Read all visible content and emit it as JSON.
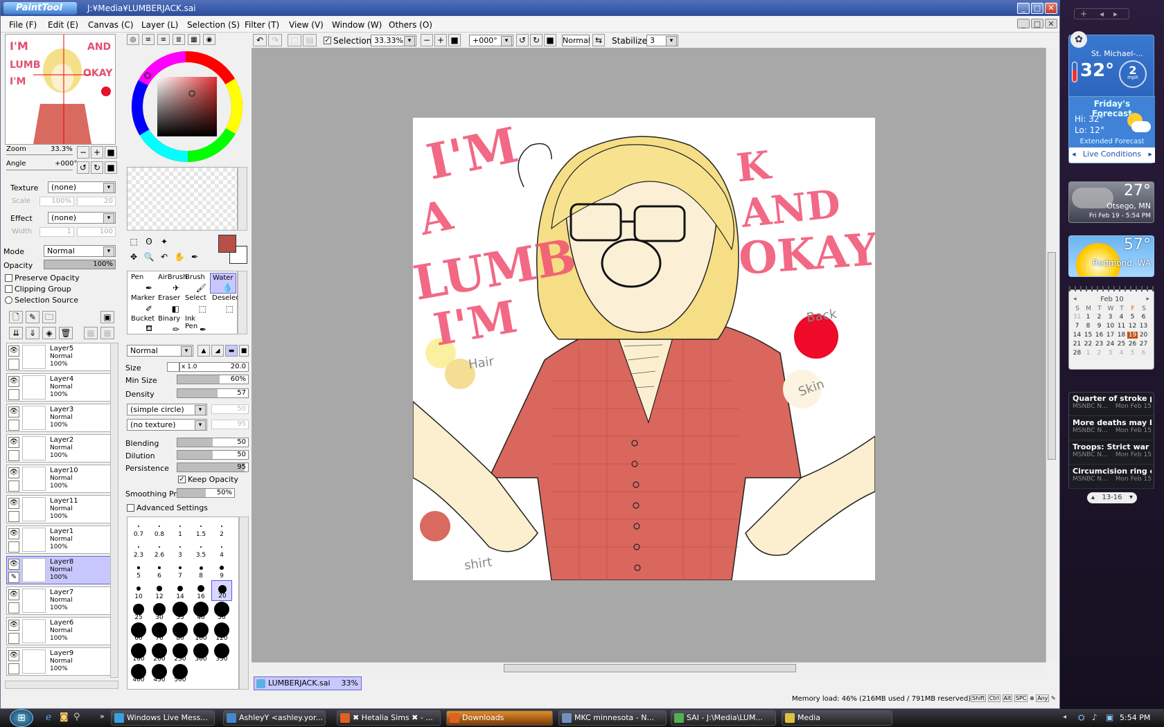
{
  "window": {
    "app": "PaintTool SAI",
    "title": "J:¥Media¥LUMBERJACK.sai"
  },
  "menu": [
    "File (F)",
    "Edit (E)",
    "Canvas (C)",
    "Layer (L)",
    "Selection (S)",
    "Filter (T)",
    "View (V)",
    "Window (W)",
    "Others (O)"
  ],
  "navigator": {
    "zoom_label": "Zoom",
    "zoom_value": "33.3%",
    "angle_label": "Angle",
    "angle_value": "+000°"
  },
  "layer_props": {
    "texture_label": "Texture",
    "texture_value": "(none)",
    "scale_label": "Scale",
    "scale_value": "100%",
    "scale_num": "20",
    "effect_label": "Effect",
    "effect_value": "(none)",
    "width_label": "Width",
    "width_value": "1",
    "width_num": "100",
    "mode_label": "Mode",
    "mode_value": "Normal",
    "opacity_label": "Opacity",
    "opacity_value": "100%",
    "preserve_opacity": "Preserve Opacity",
    "clipping_group": "Clipping Group",
    "selection_source": "Selection Source"
  },
  "layers": [
    {
      "name": "Layer5",
      "mode": "Normal",
      "opacity": "100%"
    },
    {
      "name": "Layer4",
      "mode": "Normal",
      "opacity": "100%"
    },
    {
      "name": "Layer3",
      "mode": "Normal",
      "opacity": "100%"
    },
    {
      "name": "Layer2",
      "mode": "Normal",
      "opacity": "100%"
    },
    {
      "name": "Layer10",
      "mode": "Normal",
      "opacity": "100%"
    },
    {
      "name": "Layer11",
      "mode": "Normal",
      "opacity": "100%"
    },
    {
      "name": "Layer1",
      "mode": "Normal",
      "opacity": "100%"
    },
    {
      "name": "Layer8",
      "mode": "Normal",
      "opacity": "100%",
      "selected": true
    },
    {
      "name": "Layer7",
      "mode": "Normal",
      "opacity": "100%"
    },
    {
      "name": "Layer6",
      "mode": "Normal",
      "opacity": "100%"
    },
    {
      "name": "Layer9",
      "mode": "Normal",
      "opacity": "100%"
    }
  ],
  "tools": [
    {
      "label": "Pen"
    },
    {
      "label": "AirBrush"
    },
    {
      "label": "Brush"
    },
    {
      "label": "Water"
    },
    {
      "label": "Marker"
    },
    {
      "label": "Eraser"
    },
    {
      "label": "Select"
    },
    {
      "label": "Deselect"
    },
    {
      "label": "Bucket"
    },
    {
      "label": "Binary"
    },
    {
      "label": "Ink Pen"
    }
  ],
  "brush": {
    "blend_mode": "Normal",
    "size_label": "Size",
    "size_mult": "x 1.0",
    "size_value": "20.0",
    "minsize_label": "Min Size",
    "minsize_value": "60%",
    "minsize_frac": 0.6,
    "density_label": "Density",
    "density_value": "57",
    "density_frac": 0.57,
    "shape": "(simple circle)",
    "shape_num": "50",
    "texture": "(no texture)",
    "texture_num": "95",
    "blending_label": "Blending",
    "blending_value": "50",
    "blending_frac": 0.5,
    "dilution_label": "Dilution",
    "dilution_value": "50",
    "dilution_frac": 0.5,
    "persistence_label": "Persistence",
    "persistence_value": "95",
    "persistence_frac": 0.95,
    "keep_opacity": "Keep Opacity",
    "smoothing_label": "Smoothing Prs",
    "smoothing_value": "50%",
    "smoothing_frac": 0.5,
    "advanced": "Advanced Settings"
  },
  "brush_sizes": [
    "0.7",
    "0.8",
    "1",
    "1.5",
    "2",
    "2.3",
    "2.6",
    "3",
    "3.5",
    "4",
    "5",
    "6",
    "7",
    "8",
    "9",
    "10",
    "12",
    "14",
    "16",
    "20",
    "25",
    "30",
    "35",
    "40",
    "50",
    "60",
    "70",
    "80",
    "100",
    "120",
    "160",
    "200",
    "250",
    "300",
    "350",
    "400",
    "450",
    "500"
  ],
  "toolbar": {
    "selection_label": "Selection",
    "zoom": "33.33%",
    "angle": "+000°",
    "mode": "Normal",
    "stabilizer_label": "Stabilizer",
    "stabilizer_value": "3"
  },
  "artwork": {
    "text_line1": "I'M",
    "text_line2": "A",
    "text_line3": "LUMB",
    "text_line4": "I'M",
    "text_right1": "K AND",
    "text_right2": "OKAY",
    "swatch_hair": "Hair",
    "swatch_back": "Back",
    "swatch_skin": "Skin",
    "swatch_shirt": "shirt"
  },
  "document_tab": {
    "name": "LUMBERJACK.sai",
    "zoom": "33%"
  },
  "status": {
    "memory": "Memory load: 46% (216MB used / 791MB reserved)",
    "keys": [
      "Shift",
      "Ctrl",
      "Alt",
      "SPC"
    ],
    "any": "Any"
  },
  "weather1": {
    "location": "St. Michael-...",
    "temp": "32°",
    "wind": "2",
    "wind_unit": "mph",
    "forecast_title": "Friday's Forecast",
    "hi": "Hi: 32°",
    "lo": "Lo: 12°",
    "extended": "Extended Forecast",
    "live": "Live Conditions"
  },
  "weather2": {
    "temp": "27°",
    "location": "Otsego, MN",
    "date": "Fri Feb 19 - 5:54 PM"
  },
  "weather3": {
    "temp": "57°",
    "location": "Redmond, WA"
  },
  "calendar": {
    "month": "Feb 10",
    "days_header": [
      "S",
      "M",
      "T",
      "W",
      "T",
      "F",
      "S"
    ],
    "weeks": [
      [
        "31",
        "1",
        "2",
        "3",
        "4",
        "5",
        "6"
      ],
      [
        "7",
        "8",
        "9",
        "10",
        "11",
        "12",
        "13"
      ],
      [
        "14",
        "15",
        "16",
        "17",
        "18",
        "19",
        "20"
      ],
      [
        "21",
        "22",
        "23",
        "24",
        "25",
        "26",
        "27"
      ],
      [
        "28",
        "1",
        "2",
        "3",
        "4",
        "5",
        "6"
      ]
    ],
    "today": "19"
  },
  "news": {
    "items": [
      {
        "title": "Quarter of stroke pat...",
        "source": "MSNBC N...",
        "date": "Mon Feb 15"
      },
      {
        "title": "More deaths may be...",
        "source": "MSNBC N...",
        "date": "Mon Feb 15"
      },
      {
        "title": "Troops: Strict war rul...",
        "source": "MSNBC N...",
        "date": "Mon Feb 15"
      },
      {
        "title": "Circumcision ring cut...",
        "source": "MSNBC N...",
        "date": "Mon Feb 15"
      }
    ],
    "pager": "13-16"
  },
  "taskbar": {
    "items": [
      {
        "label": "Windows Live Mess...",
        "color": "#3aa0e0"
      },
      {
        "label": "AshleyY <ashley.yor...",
        "color": "#4488cc"
      },
      {
        "label": "✖ Hetalia Sims ✖ - ...",
        "color": "#e06020"
      },
      {
        "label": "Downloads",
        "color": "#e06020",
        "active": true
      },
      {
        "label": "MKC minnesota - N...",
        "color": "#7090c0"
      },
      {
        "label": "SAI - J:\\Media\\LUM...",
        "color": "#50b050"
      },
      {
        "label": "Media",
        "color": "#e0c040"
      }
    ],
    "clock": "5:54 PM"
  }
}
